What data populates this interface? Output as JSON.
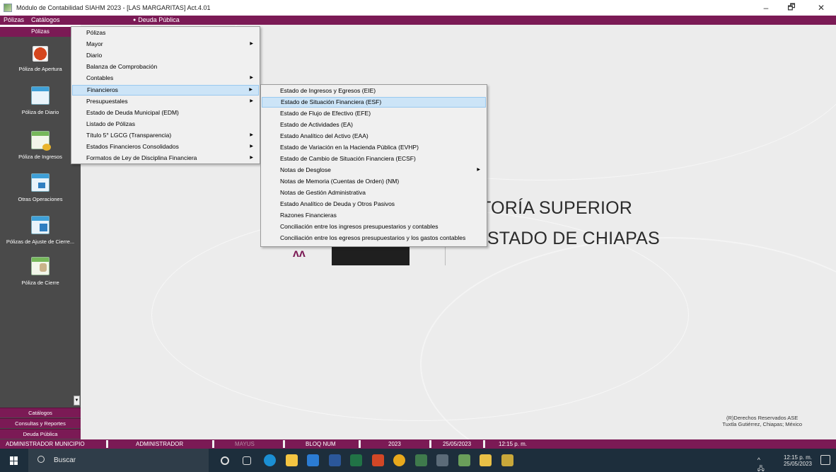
{
  "window": {
    "title": "Módulo de Contabilidad SIAHM 2023 - [LAS MARGARITAS] Act.4.01",
    "controls": {
      "minimize": "–",
      "maximize": "🗗",
      "close": "✕"
    }
  },
  "menubar": {
    "items": [
      "Pólizas",
      "Catálogos"
    ],
    "active_item": "",
    "deuda": "Deuda Pública"
  },
  "leftpanel": {
    "header": "Pólizas",
    "tools": [
      {
        "label": "Póliza de Apertura",
        "icon": "apertura-icon"
      },
      {
        "label": "Póliza de Diario",
        "icon": "diario-icon"
      },
      {
        "label": "Póliza de Ingresos",
        "icon": "ingresos-icon"
      },
      {
        "label": "Otras Operaciones",
        "icon": "otras-operaciones-icon"
      },
      {
        "label": "Pólizas de Ajuste de Cierre...",
        "icon": "ajuste-cierre-icon"
      },
      {
        "label": "Póliza de Cierre",
        "icon": "cierre-icon"
      }
    ],
    "nav": [
      "Catálogos",
      "Consultas y Reportes",
      "Deuda Pública"
    ]
  },
  "menu1": {
    "items": [
      {
        "label": "Pólizas",
        "submenu": false
      },
      {
        "label": "Mayor",
        "submenu": true
      },
      {
        "label": "Diario",
        "submenu": false
      },
      {
        "label": "Balanza de Comprobación",
        "submenu": false
      },
      {
        "label": "Contables",
        "submenu": true
      },
      {
        "label": "Financieros",
        "submenu": true,
        "highlighted": true
      },
      {
        "label": "Presupuestales",
        "submenu": true
      },
      {
        "label": "Estado de Deuda Municipal (EDM)",
        "submenu": false
      },
      {
        "label": "Listado de Pólizas",
        "submenu": false
      },
      {
        "label": "Título 5° LGCG (Transparencia)",
        "submenu": true
      },
      {
        "label": "Estados Financieros Consolidados",
        "submenu": true
      },
      {
        "label": "Formatos de Ley de Disciplina Financiera",
        "submenu": true
      }
    ]
  },
  "menu2": {
    "items": [
      {
        "label": "Estado de Ingresos y Egresos (EIE)",
        "submenu": false
      },
      {
        "label": "Estado de Situación Financiera (ESF)",
        "submenu": false,
        "highlighted": true
      },
      {
        "label": "Estado de Flujo de Efectivo (EFE)",
        "submenu": false
      },
      {
        "label": "Estado de Actividades (EA)",
        "submenu": false
      },
      {
        "label": "Estado Analítico del Activo (EAA)",
        "submenu": false
      },
      {
        "label": "Estado de Variación en la Hacienda Pública (EVHP)",
        "submenu": false
      },
      {
        "label": "Estado de Cambio de Situación Financiera (ECSF)",
        "submenu": false
      },
      {
        "label": "Notas de Desglose",
        "submenu": true
      },
      {
        "label": "Notas de Memoria (Cuentas de Orden) (NM)",
        "submenu": false
      },
      {
        "label": "Notas de Gestión Administrativa",
        "submenu": false
      },
      {
        "label": "Estado Analítico de Deuda y Otros Pasivos",
        "submenu": false
      },
      {
        "label": "Razones Financieras",
        "submenu": false
      },
      {
        "label": "Conciliación entre los ingresos presupuestarios y contables",
        "submenu": false
      },
      {
        "label": "Conciliación entre los egresos presupuestarios y los gastos contables",
        "submenu": false
      }
    ]
  },
  "background": {
    "logo_line1": "ITORÍA SUPERIOR",
    "logo_line2": "ESTADO DE CHIAPAS",
    "copyright_line1": "(R)Derechos Reservados ASE",
    "copyright_line2": "Tuxtla Gutiérrez, Chiapas; México"
  },
  "statusbar": {
    "user": "ADMINISTRADOR MUNICIPIO",
    "role": "ADMINISTRADOR",
    "mayus": "MAYUS",
    "bloqnum": "BLOQ NUM",
    "year": "2023",
    "date": "25/05/2023",
    "time": "12:15 p. m."
  },
  "taskbar": {
    "search_label": "Buscar",
    "clock_time": "12:15 p. m.",
    "clock_date": "25/05/2023",
    "tray_icons": "^ 🖧 🔊",
    "apps": [
      {
        "name": "cortana-icon",
        "color": "#1d2e3c"
      },
      {
        "name": "taskview-icon",
        "color": "#1d2e3c"
      },
      {
        "name": "edge-icon",
        "color": "#1b8fd3"
      },
      {
        "name": "explorer-icon",
        "color": "#f4c542"
      },
      {
        "name": "mail-icon",
        "color": "#2b7cd3"
      },
      {
        "name": "word-icon",
        "color": "#2b579a"
      },
      {
        "name": "excel-icon",
        "color": "#217346"
      },
      {
        "name": "powerpoint-icon",
        "color": "#d24726"
      },
      {
        "name": "chrome-icon",
        "color": "#e8a91c"
      },
      {
        "name": "app-green-icon",
        "color": "#3f7a4c"
      },
      {
        "name": "store-icon",
        "color": "#5b6b78"
      },
      {
        "name": "siahm-icon",
        "color": "#6a9e5a"
      },
      {
        "name": "app-yellow-icon",
        "color": "#e9c046"
      },
      {
        "name": "app-star-icon",
        "color": "#c9a83a"
      }
    ]
  },
  "colors": {
    "accent": "#7b1a55",
    "highlight": "#cce4f7",
    "panel": "#4a4a4a"
  }
}
